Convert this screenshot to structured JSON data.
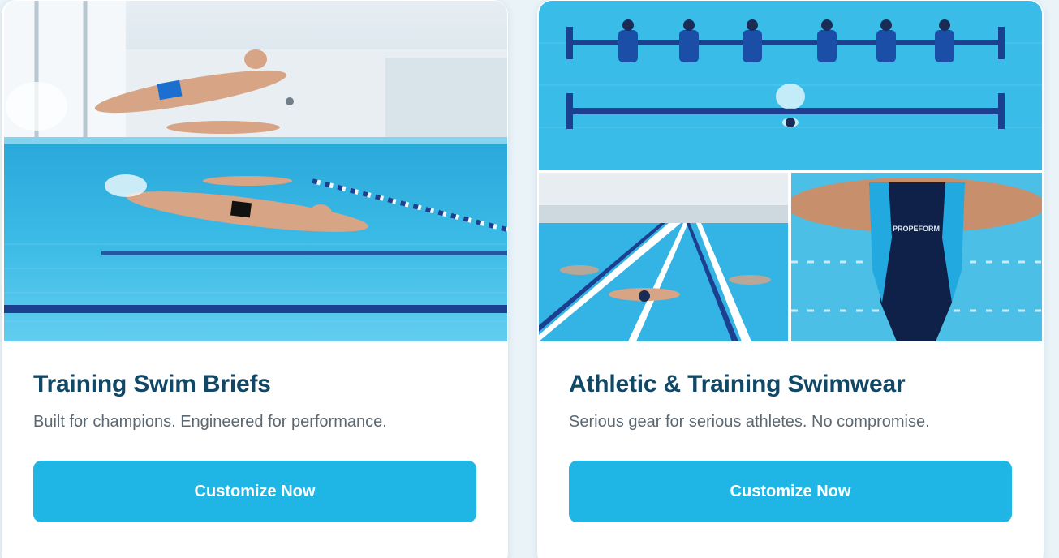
{
  "cards": [
    {
      "title": "Training Swim Briefs",
      "description": "Built for champions. Engineered for performance.",
      "button_label": "Customize Now"
    },
    {
      "title": "Athletic & Training Swimwear",
      "description": "Serious gear for serious athletes. No compromise.",
      "button_label": "Customize Now",
      "suit_logo": "PROPEFORM"
    }
  ],
  "colors": {
    "title": "#114866",
    "description": "#5b6872",
    "button": "#1fb6e6",
    "pool_water": "#33b7e6",
    "lane_line": "#1c3f8f"
  }
}
